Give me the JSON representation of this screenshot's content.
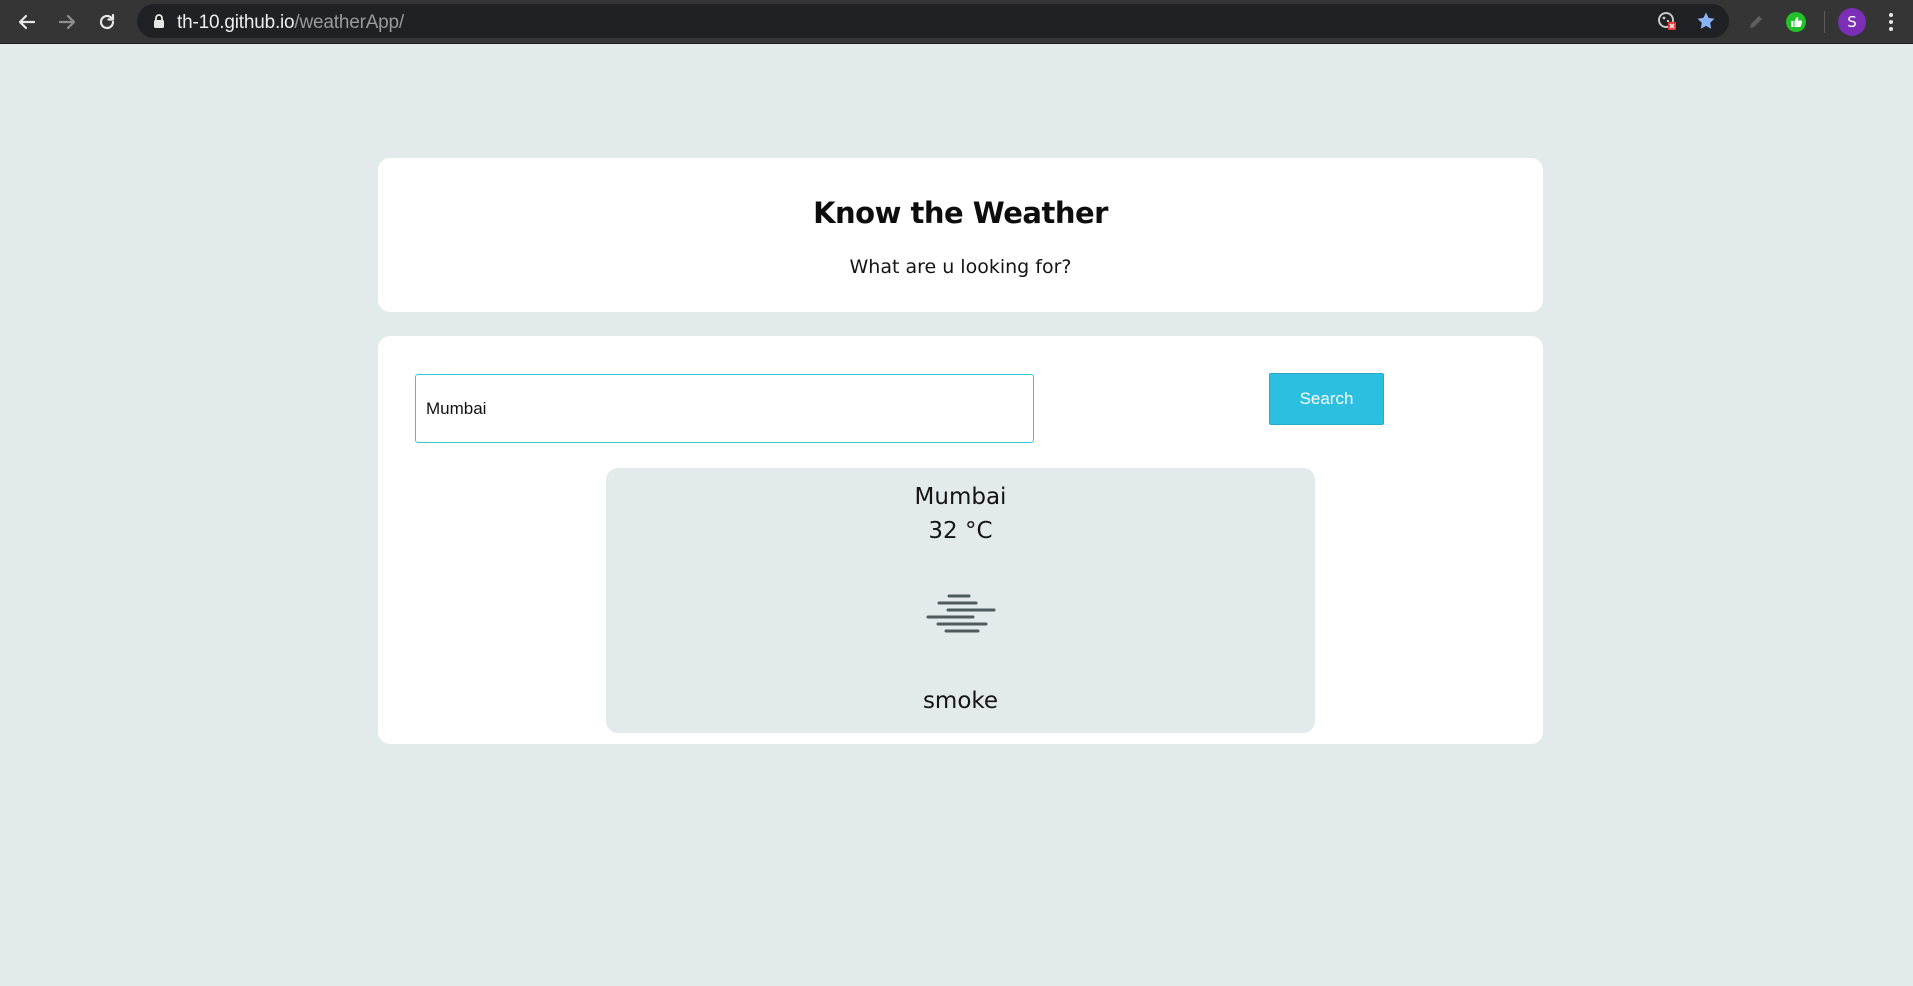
{
  "browser": {
    "url_host": "th-10.github.io",
    "url_path": "/weatherApp/",
    "profile_initial": "S",
    "icons": [
      "back-arrow-icon",
      "forward-arrow-icon",
      "reload-icon",
      "lock-icon",
      "cookie-blocked-icon",
      "bookmark-star-icon",
      "pencil-extension-icon",
      "thumbs-up-extension-icon",
      "menu-kebab-icon"
    ]
  },
  "header": {
    "title": "Know the Weather",
    "subtitle": "What are u looking for?"
  },
  "search": {
    "value": "Mumbai",
    "button_label": "Search"
  },
  "weather": {
    "city": "Mumbai",
    "temperature": "32 °C",
    "icon": "smoke-haze-icon",
    "description": "smoke"
  },
  "colors": {
    "page_bg": "#e2eaeb",
    "card_bg": "#ffffff",
    "accent": "#2dbfe0",
    "input_border": "#2ec8d6"
  }
}
